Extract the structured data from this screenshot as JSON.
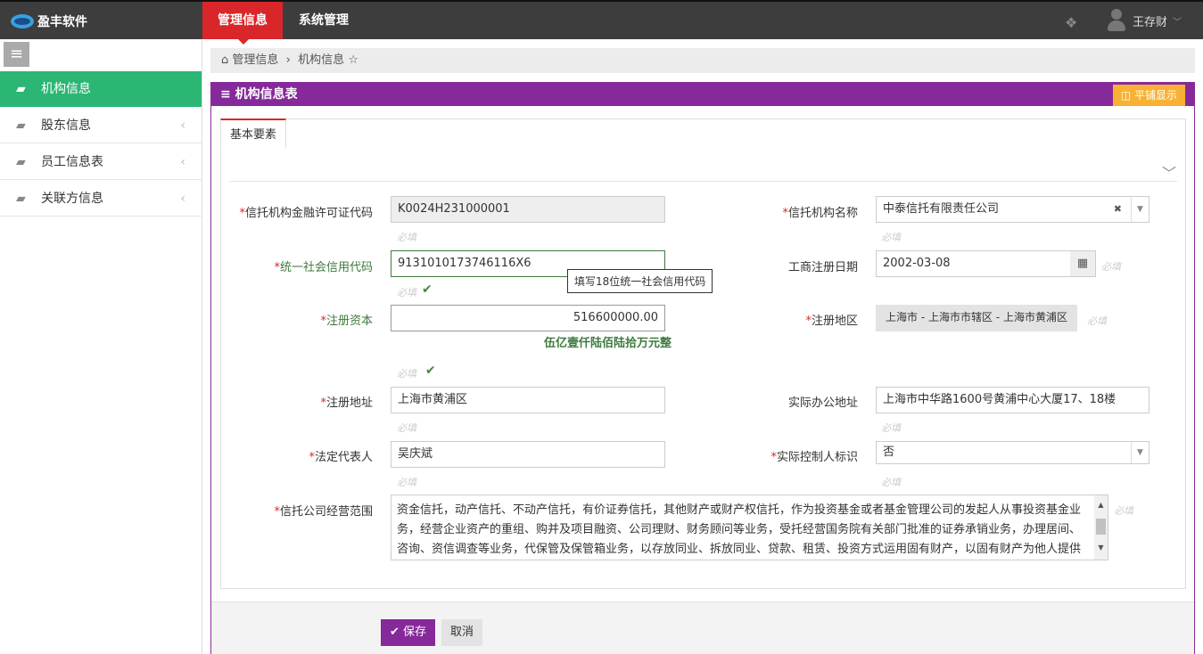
{
  "app": {
    "name": "盈丰软件"
  },
  "topnav": {
    "tabs": [
      "管理信息",
      "系统管理"
    ],
    "user": "王存财"
  },
  "sidebar": {
    "items": [
      "机构信息",
      "股东信息",
      "员工信息表",
      "关联方信息"
    ]
  },
  "breadcrumb": [
    "管理信息",
    "机构信息"
  ],
  "panel": {
    "title": "机构信息表",
    "tile_button": "平铺显示",
    "tab": "基本要素"
  },
  "form": {
    "required_hint": "必填",
    "license_code": {
      "label": "信托机构金融许可证代码",
      "value": "K0024H231000001"
    },
    "credit_code": {
      "label": "统一社会信用代码",
      "value": "9131010173746116X6",
      "tooltip": "填写18位统一社会信用代码"
    },
    "capital": {
      "label": "注册资本",
      "value": "516600000.00",
      "in_words": "伍亿壹仟陆佰陆拾万元整"
    },
    "reg_address": {
      "label": "注册地址",
      "value": "上海市黄浦区"
    },
    "legal_rep": {
      "label": "法定代表人",
      "value": "吴庆斌"
    },
    "org_name": {
      "label": "信托机构名称",
      "value": "中泰信托有限责任公司"
    },
    "reg_date": {
      "label": "工商注册日期",
      "value": "2002-03-08"
    },
    "reg_region": {
      "label": "注册地区",
      "value": "上海市 - 上海市市辖区 - 上海市黄浦区"
    },
    "office_address": {
      "label": "实际办公地址",
      "value": "上海市中华路1600号黄浦中心大厦17、18楼"
    },
    "controller_flag": {
      "label": "实际控制人标识",
      "value": "否"
    },
    "scope": {
      "label": "信托公司经营范围",
      "value": "资金信托，动产信托、不动产信托，有价证券信托，其他财产或财产权信托，作为投资基金或者基金管理公司的发起人从事投资基金业务，经营企业资产的重组、购并及项目融资、公司理财、财务顾问等业务，受托经营国务院有关部门批准的证券承销业务，办理居间、咨询、资信调查等业务，代保管及保管箱业务，以存放同业、拆放同业、贷款、租赁、投资方式运用固有财产，以固有财产为他人提供担保，从事同业拆借，法律法规规定或中国银行业监督管理委员会批准的其他业务。"
    }
  },
  "buttons": {
    "save": "保存",
    "cancel": "取消"
  }
}
